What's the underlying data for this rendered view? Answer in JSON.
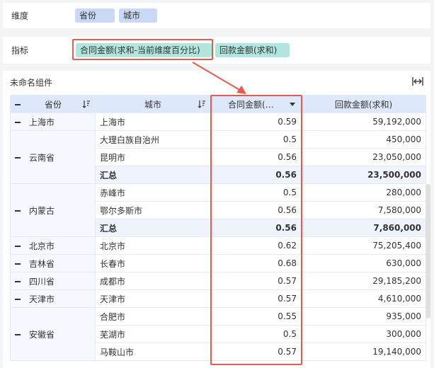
{
  "dimension_bar": {
    "label": "维度",
    "chips": [
      "省份",
      "城市"
    ]
  },
  "metric_bar": {
    "label": "指标",
    "chips": [
      "合同金额(求和-当前维度百分比)",
      "回款金额(求和)"
    ]
  },
  "component": {
    "title": "未命名组件",
    "headers": [
      "省份",
      "城市",
      "合同金额(…",
      "回款金额(求和)"
    ],
    "rows": [
      {
        "province": "上海市",
        "city": "上海市",
        "contract": "0.59",
        "payment": "59,192,000"
      },
      {
        "province": "云南省",
        "city": "大理白族自治州",
        "contract": "0.5",
        "payment": "450,000"
      },
      {
        "province": "",
        "city": "昆明市",
        "contract": "0.56",
        "payment": "23,050,000"
      },
      {
        "province": "",
        "city": "汇总",
        "contract": "0.56",
        "payment": "23,500,000",
        "total": true
      },
      {
        "province": "内蒙古",
        "city": "赤峰市",
        "contract": "0.5",
        "payment": "280,000"
      },
      {
        "province": "",
        "city": "鄂尔多斯市",
        "contract": "0.56",
        "payment": "7,580,000"
      },
      {
        "province": "",
        "city": "汇总",
        "contract": "0.56",
        "payment": "7,860,000",
        "total": true
      },
      {
        "province": "北京市",
        "city": "北京市",
        "contract": "0.62",
        "payment": "75,205,400"
      },
      {
        "province": "吉林省",
        "city": "长春市",
        "contract": "0.68",
        "payment": "630,000"
      },
      {
        "province": "四川省",
        "city": "成都市",
        "contract": "0.57",
        "payment": "29,185,200"
      },
      {
        "province": "天津市",
        "city": "天津市",
        "contract": "0.57",
        "payment": "4,610,000"
      },
      {
        "province": "安徽省",
        "city": "合肥市",
        "contract": "0.55",
        "payment": "935,000"
      },
      {
        "province": "",
        "city": "芜湖市",
        "contract": "0.5",
        "payment": "300,000"
      },
      {
        "province": "",
        "city": "马鞍山市",
        "contract": "0.57",
        "payment": "19,140,000"
      }
    ]
  },
  "colors": {
    "dimension_chip": "#c8d8f5",
    "metric_chip": "#b1e6de",
    "highlight": "#e45b4f",
    "header_bg": "#dde8fb"
  }
}
